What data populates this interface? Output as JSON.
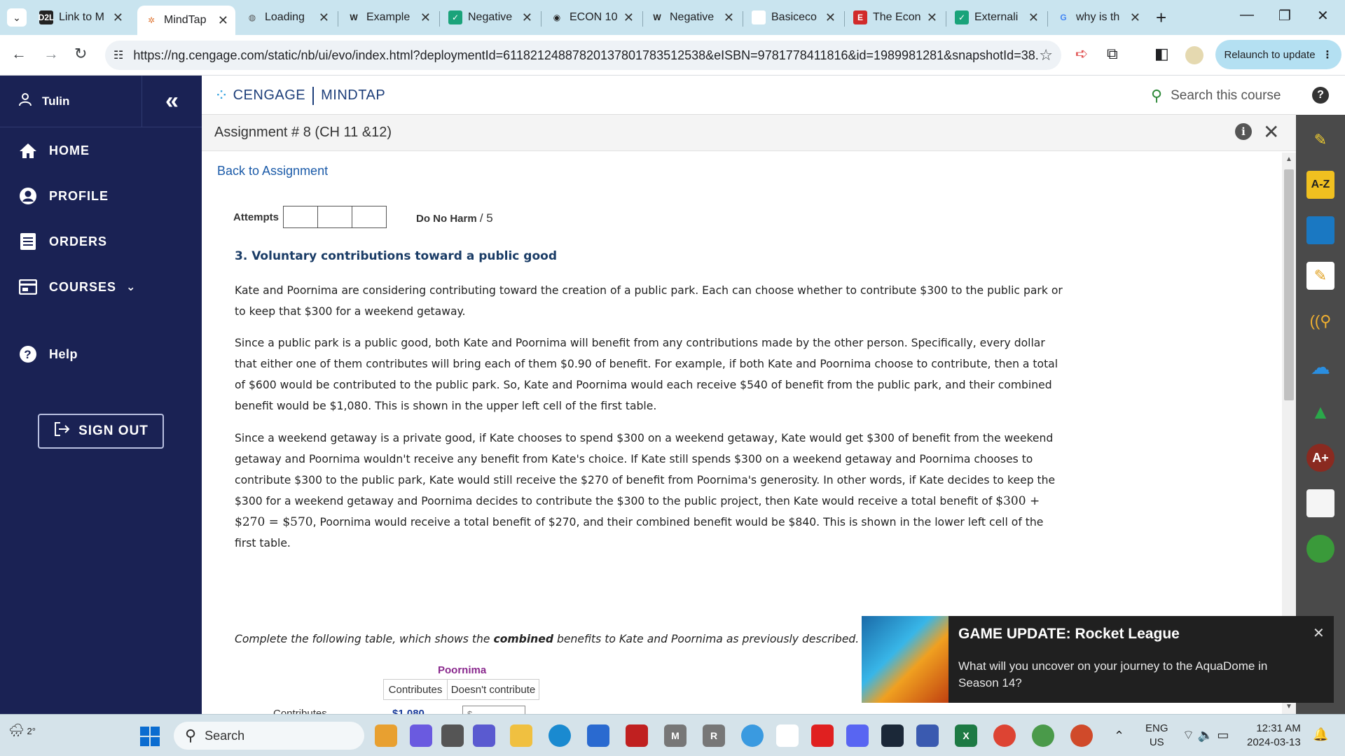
{
  "browser": {
    "tabs": [
      {
        "label": "Link to M",
        "fav": "D2L",
        "favbg": "#222",
        "favfg": "#fff"
      },
      {
        "label": "MindTap",
        "fav": "✲",
        "favbg": "#fff",
        "favfg": "#e07a3a",
        "active": true
      },
      {
        "label": "Loading",
        "fav": "◍",
        "favbg": "transparent",
        "favfg": "#555"
      },
      {
        "label": "Example",
        "fav": "W",
        "favbg": "transparent",
        "favfg": "#222"
      },
      {
        "label": "Negative",
        "fav": "✓",
        "favbg": "#1aa37a",
        "favfg": "#fff"
      },
      {
        "label": "ECON 10",
        "fav": "◉",
        "favbg": "transparent",
        "favfg": "#222"
      },
      {
        "label": "Negative",
        "fav": "W",
        "favbg": "transparent",
        "favfg": "#222"
      },
      {
        "label": "Basiceco",
        "fav": "",
        "favbg": "#fff",
        "favfg": "#fff"
      },
      {
        "label": "The Econ",
        "fav": "E",
        "favbg": "#d12a2a",
        "favfg": "#fff"
      },
      {
        "label": "Externali",
        "fav": "✓",
        "favbg": "#1aa37a",
        "favfg": "#fff"
      },
      {
        "label": "why is th",
        "fav": "G",
        "favbg": "transparent",
        "favfg": "#4285f4"
      }
    ],
    "url": "https://ng.cengage.com/static/nb/ui/evo/index.html?deploymentId=61182124887820137801783512538&eISBN=9781778411816&id=1989981281&snapshotId=38...",
    "relaunch_label": "Relaunch to update"
  },
  "sidenav": {
    "user_name": "Tulin",
    "items": [
      {
        "label": "HOME",
        "icon": "home-icon"
      },
      {
        "label": "PROFILE",
        "icon": "profile-icon"
      },
      {
        "label": "ORDERS",
        "icon": "orders-icon"
      },
      {
        "label": "COURSES",
        "icon": "courses-icon"
      },
      {
        "label": "Help",
        "icon": "help-icon"
      }
    ],
    "signout_label": "SIGN OUT"
  },
  "header": {
    "brand": "CENGAGE",
    "product": "MINDTAP",
    "search_placeholder": "Search this course"
  },
  "assignment": {
    "title": "Assignment # 8 (CH 11 &12)",
    "back_label": "Back to Assignment",
    "attempts_label": "Attempts",
    "score_name": "Do No Harm",
    "score_total": "/ 5",
    "question_title": "3. Voluntary contributions toward a public good",
    "para1": "Kate and Poornima are considering contributing toward the creation of a public park. Each can choose whether to contribute $300 to the public park or to keep that $300 for a weekend getaway.",
    "para2": "Since a public park is a public good, both Kate and Poornima will benefit from any contributions made by the other person. Specifically, every dollar that either one of them contributes will bring each of them $0.90 of benefit. For example, if both Kate and Poornima choose to contribute, then a total of $600 would be contributed to the public park. So, Kate and Poornima would each receive $540 of benefit from the public park, and their combined benefit would be $1,080. This is shown in the upper left cell of the first table.",
    "para3_a": "Since a weekend getaway is a private good, if Kate chooses to spend $300 on a weekend getaway, Kate would get $300 of benefit from the weekend getaway and Poornima wouldn't receive any benefit from Kate's choice. If Kate still spends $300 on a weekend getaway and Poornima chooses to contribute $300 to the public park, Kate would still receive the $270 of benefit from Poornima's generosity. In other words, if Kate decides to keep the $300 for a weekend getaway and Poornima decides to contribute the $300 to the public project, then Kate would receive a total benefit of",
    "para3_math": "$300 + $270 = $570",
    "para3_b": ", Poornima would receive a total benefit of $270, and their combined benefit would be $840. This is shown in the lower left cell of the first table.",
    "instr_a": "Complete the following table, which shows the ",
    "instr_bold": "combined",
    "instr_b": " benefits to Kate and Poornima as previously described.",
    "table": {
      "col_player": "Poornima",
      "col1": "Contributes",
      "col2": "Doesn't contribute",
      "row1_label": "Contributes",
      "row1_value": "$1,080",
      "input_placeholder": "$"
    }
  },
  "toast": {
    "title": "GAME UPDATE: Rocket League",
    "body": "What will you uncover on your journey to the AquaDome in Season 14?"
  },
  "taskbar": {
    "weather": "2°",
    "search_label": "Search",
    "lang_line1": "ENG",
    "lang_line2": "US",
    "time": "12:31 AM",
    "date": "2024-03-13"
  }
}
